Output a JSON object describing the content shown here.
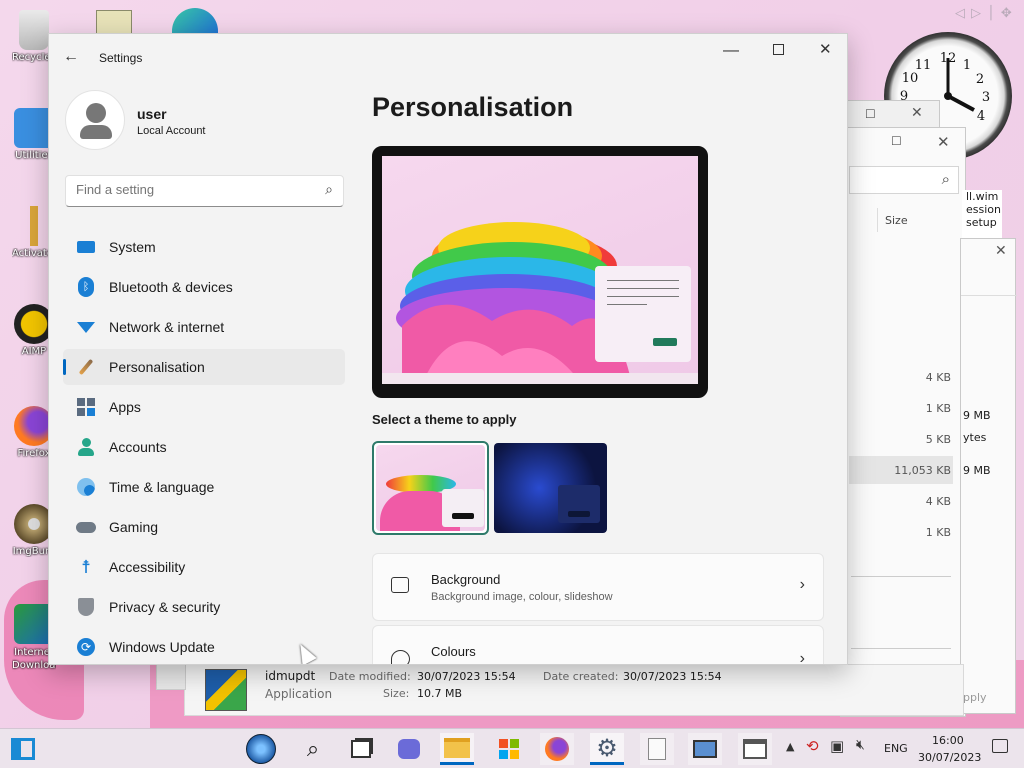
{
  "desktop_icons": [
    {
      "label": "Recycle Bin"
    },
    {
      "label": "Utilities"
    },
    {
      "label": "Activate Windows"
    },
    {
      "label": "AIMP"
    },
    {
      "label": "Firefox"
    },
    {
      "label": "ImgBurn"
    },
    {
      "label": "Internet Download Manager"
    }
  ],
  "explorer": {
    "column_size": "Size",
    "sizes": [
      "4 KB",
      "1 KB",
      "5 KB",
      "11,053 KB",
      "4 KB",
      "1 KB"
    ],
    "side_texts": [
      "9 MB",
      "ytes",
      "9 MB"
    ],
    "side_file": [
      "ll.wim",
      "ession",
      "setup"
    ],
    "details": {
      "name": "idmupdt",
      "type": "Application",
      "date_modified_label": "Date modified:",
      "date_modified": "30/07/2023 15:54",
      "size_label": "Size:",
      "size": "10.7 MB",
      "date_created_label": "Date created:",
      "date_created": "30/07/2023 15:54"
    },
    "apply_label": "pply"
  },
  "settings": {
    "title": "Settings",
    "user_name": "user",
    "account_type": "Local Account",
    "search_placeholder": "Find a setting",
    "nav": [
      {
        "label": "System",
        "icon": "system-icon"
      },
      {
        "label": "Bluetooth & devices",
        "icon": "bluetooth-icon"
      },
      {
        "label": "Network & internet",
        "icon": "wifi-icon"
      },
      {
        "label": "Personalisation",
        "icon": "brush-icon"
      },
      {
        "label": "Apps",
        "icon": "apps-icon"
      },
      {
        "label": "Accounts",
        "icon": "person-icon"
      },
      {
        "label": "Time & language",
        "icon": "globe-clock-icon"
      },
      {
        "label": "Gaming",
        "icon": "gamepad-icon"
      },
      {
        "label": "Accessibility",
        "icon": "accessibility-icon"
      },
      {
        "label": "Privacy & security",
        "icon": "shield-icon"
      },
      {
        "label": "Windows Update",
        "icon": "update-icon"
      }
    ],
    "selected": "Personalisation",
    "page_title": "Personalisation",
    "theme_heading": "Select a theme to apply",
    "cards": [
      {
        "title": "Background",
        "subtitle": "Background image, colour, slideshow",
        "icon": "image-icon"
      },
      {
        "title": "Colours",
        "subtitle": "",
        "icon": "palette-icon"
      }
    ]
  },
  "tray": {
    "language": "ENG",
    "time": "16:00",
    "date": "30/07/2023"
  },
  "colors": {
    "accent": "#0067c0",
    "desktop": "#f1cfe8"
  }
}
